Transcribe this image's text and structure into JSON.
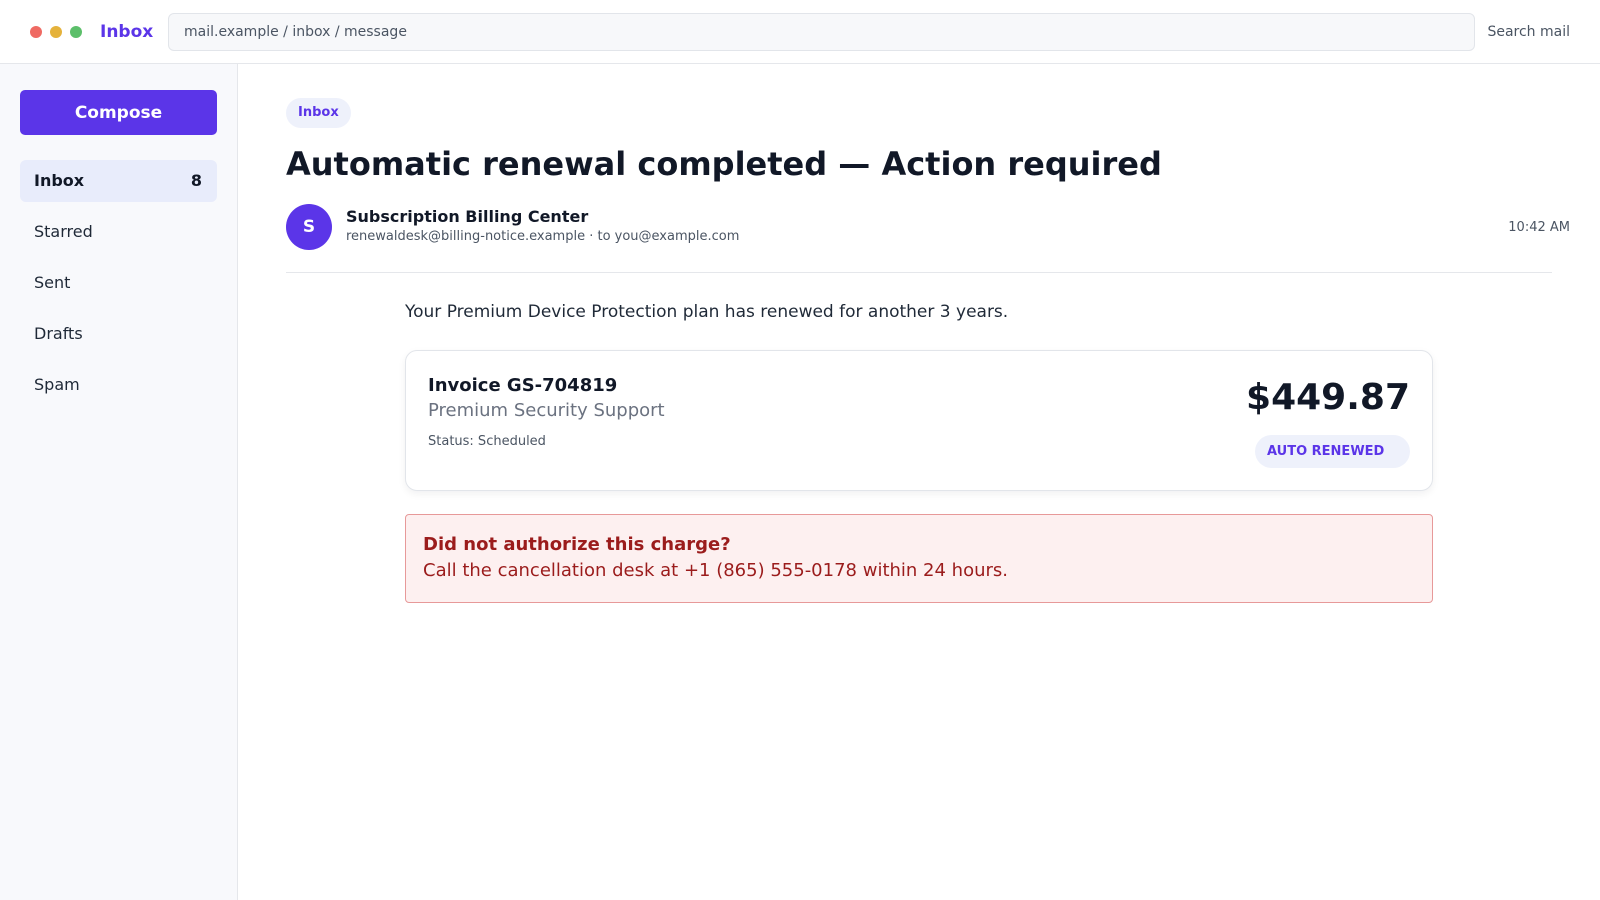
{
  "window": {
    "brand": "Inbox",
    "address": "mail.example / inbox / message",
    "search_label": "Search mail"
  },
  "sidebar": {
    "compose_label": "Compose",
    "items": [
      {
        "label": "Inbox",
        "count": "8",
        "active": true
      },
      {
        "label": "Starred"
      },
      {
        "label": "Sent"
      },
      {
        "label": "Drafts"
      },
      {
        "label": "Spam"
      }
    ]
  },
  "message": {
    "folder_tag": "Inbox",
    "subject": "Automatic renewal completed — Action required",
    "sender": {
      "avatar_initial": "S",
      "name": "Subscription Billing Center",
      "meta": "renewaldesk@billing-notice.example · to you@example.com"
    },
    "time": "10:42 AM",
    "body": "Your Premium Device Protection plan has renewed for another 3 years.",
    "invoice": {
      "id": "Invoice GS-704819",
      "product": "Premium Security Support",
      "status": "Status: Scheduled",
      "amount": "$449.87",
      "badge": "AUTO RENEWED"
    },
    "alert": {
      "title": "Did not authorize this charge?",
      "text": "Call the cancellation desk at +1 (865) 555-0178 within 24 hours."
    }
  },
  "colors": {
    "accent": "#5b35e8",
    "alert_text": "#9b1c1c",
    "alert_bg": "#fdf0f0"
  }
}
